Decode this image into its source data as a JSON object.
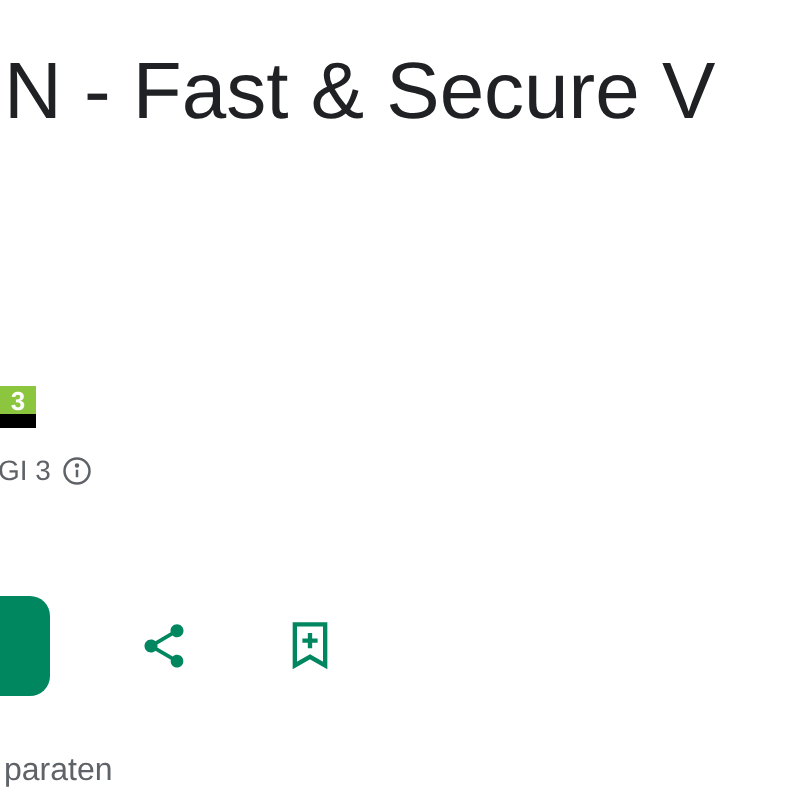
{
  "title": "N - Fast & Secure V",
  "rating_badge": {
    "label": "3"
  },
  "rating_text": "GI 3",
  "footer_text": "paraten"
}
